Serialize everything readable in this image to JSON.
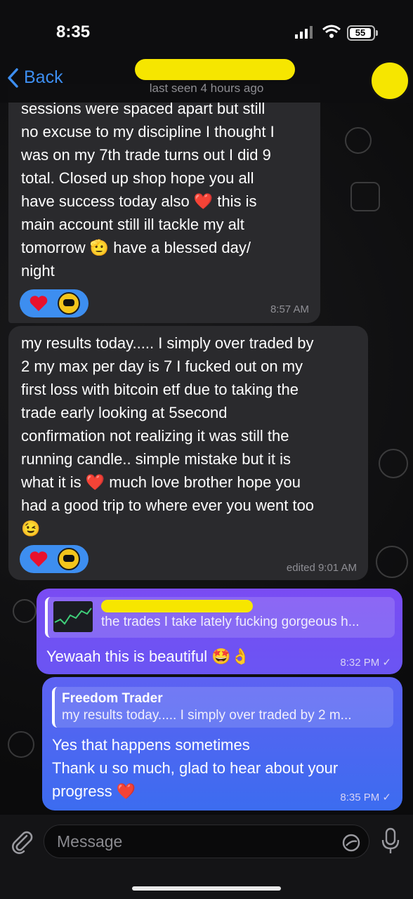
{
  "status": {
    "time": "8:35",
    "battery": "55"
  },
  "header": {
    "back_label": "Back",
    "subtitle": "last seen 4 hours ago"
  },
  "messages": [
    {
      "text": "sessions were spaced apart but still\nno excuse to my discipline I thought I\nwas on my 7th trade turns out I did 9\ntotal. Closed up shop hope you all\nhave success today also ❤️ this is\nmain account still ill tackle my alt\ntomorrow 🫡 have a blessed day/\nnight",
      "time": "8:57 AM"
    },
    {
      "text": "my results today..... I simply over traded by\n2 my max per day is 7 I fucked out on my\nfirst loss with bitcoin etf due to taking the\ntrade early looking at 5second\nconfirmation not realizing it was still the\nrunning candle.. simple mistake but it is\nwhat it is ❤️ much love brother hope you\nhad a good trip to where ever you went too\n😉",
      "time": "edited 9:01 AM"
    },
    {
      "reply_text": "the trades I take lately fucking gorgeous h...",
      "text": "Yewaah this is beautiful 🤩👌",
      "time": "8:32 PM"
    },
    {
      "reply_name": "Freedom Trader",
      "reply_text": "my results today..... I simply over traded by 2 m...",
      "text": "Yes that happens sometimes\nThank u so much, glad to hear about your\nprogress ❤️",
      "time": "8:35 PM"
    }
  ],
  "input": {
    "placeholder": "Message"
  },
  "colors": {
    "accent": "#3d8ef0",
    "redact": "#f6e600",
    "out_top": "#7a4cf3",
    "out_bottom": "#3c6cf0"
  }
}
